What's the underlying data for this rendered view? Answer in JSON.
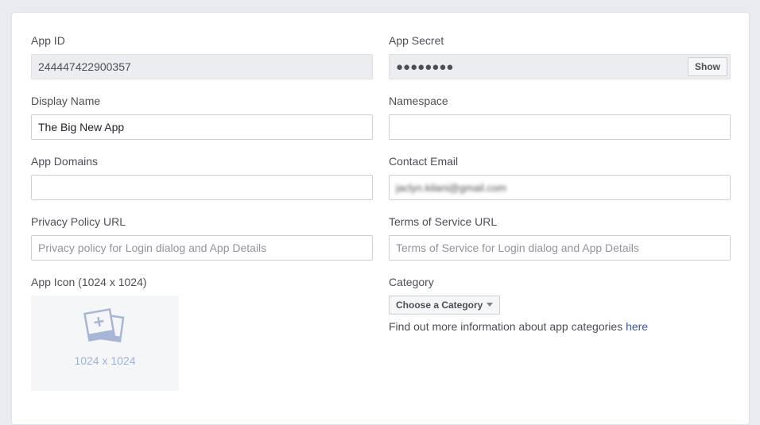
{
  "app_id": {
    "label": "App ID",
    "value": "244447422900357"
  },
  "app_secret": {
    "label": "App Secret",
    "value": "●●●●●●●●",
    "show_button": "Show"
  },
  "display_name": {
    "label": "Display Name",
    "value": "The Big New App"
  },
  "namespace": {
    "label": "Namespace",
    "value": ""
  },
  "app_domains": {
    "label": "App Domains",
    "value": ""
  },
  "contact_email": {
    "label": "Contact Email",
    "value": "jaclyn.kilani@gmail.com"
  },
  "privacy_policy_url": {
    "label": "Privacy Policy URL",
    "placeholder": "Privacy policy for Login dialog and App Details"
  },
  "terms_of_service_url": {
    "label": "Terms of Service URL",
    "placeholder": "Terms of Service for Login dialog and App Details"
  },
  "app_icon": {
    "label": "App Icon (1024 x 1024)",
    "size_text": "1024 x 1024",
    "icon": "add-photo-icon"
  },
  "category": {
    "label": "Category",
    "selected": "Choose a Category",
    "help_text": "Find out more information about app categories ",
    "help_link": "here"
  },
  "colors": {
    "background": "#e9ebee",
    "panel": "#ffffff",
    "readonly_field": "#ebedf0",
    "link": "#365899",
    "icon_tint": "#9cb4d8"
  }
}
